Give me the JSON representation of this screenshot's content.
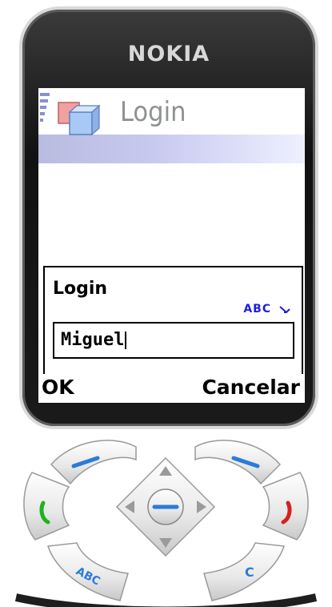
{
  "device": {
    "brand": "NOKIA"
  },
  "screen": {
    "app_title": "Login",
    "dialog": {
      "title": "Login",
      "input_mode_indicator": "ABC",
      "input_value": "Miguel"
    },
    "softkeys": {
      "left_label": "OK",
      "right_label": "Cancelar"
    }
  },
  "keypad": {
    "abc_key_label": "ABC",
    "clear_key_label": "C",
    "icons": [
      "call-icon",
      "end-call-icon",
      "nav-up-icon",
      "nav-down-icon",
      "nav-left-icon",
      "nav-right-icon",
      "select-icon"
    ]
  },
  "colors": {
    "indicator_blue": "#1e1ee0",
    "call_green": "#1fb31f",
    "end_red": "#d62020",
    "softkey_blue": "#2b7bd8"
  }
}
